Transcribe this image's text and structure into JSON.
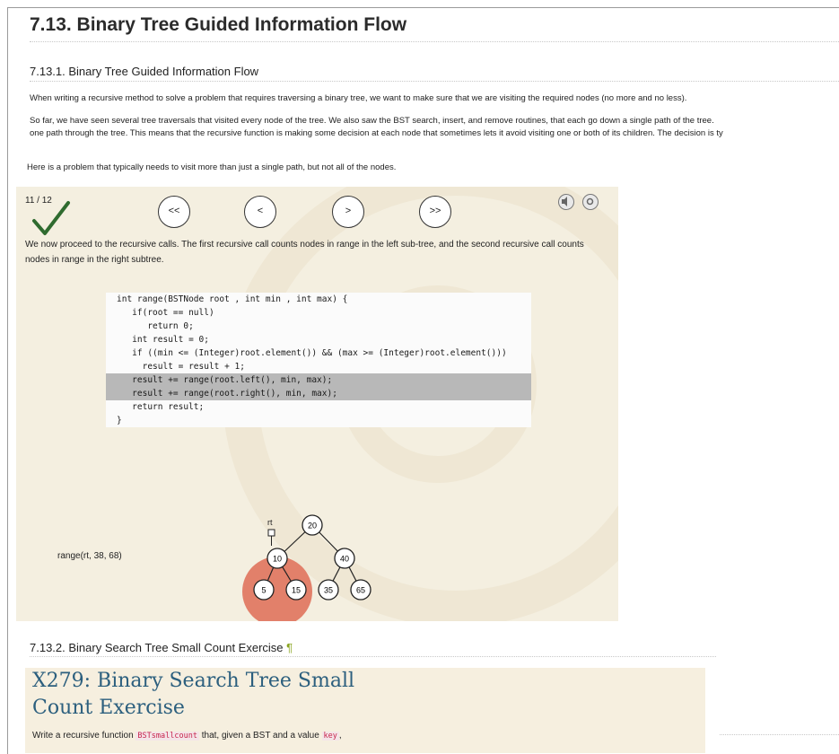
{
  "page": {
    "title": "7.13. Binary Tree Guided Information Flow",
    "section1_heading": "7.13.1. Binary Tree Guided Information Flow",
    "para1": "When writing a recursive method to solve a problem that requires traversing a binary tree, we want to make sure that we are visiting the required nodes (no more and no less).",
    "para2_line1": "So far, we have seen several tree traversals that visited every node of the tree. We also saw the BST search, insert, and remove routines, that each go down a single path of the tree.",
    "para2_line2": "one path through the tree. This means that the recursive function is making some decision at each node that sometimes lets it avoid visiting one or both of its children. The decision is ty",
    "para3": "Here is a problem that typically needs to visit more than just a single path, but not all of the nodes."
  },
  "slideshow": {
    "counter": "11 / 12",
    "buttons": {
      "first": "<<",
      "prev": "<",
      "next": ">",
      "last": ">>"
    },
    "description": "We now proceed to the recursive calls. The first recursive call counts nodes in range in the left sub-tree, and the second recursive call counts nodes in range in the right subtree.",
    "code_lines": [
      "int range(BSTNode root , int min , int max) {",
      "   if(root == null)",
      "      return 0;",
      "   int result = 0;",
      "   if ((min <= (Integer)root.element()) && (max >= (Integer)root.element()))",
      "     result = result + 1;",
      "   result += range(root.left(), min, max);",
      "   result += range(root.right(), min, max);",
      "   return result;",
      "}"
    ],
    "highlighted_lines": [
      6,
      7
    ],
    "call_label": "range(rt, 38, 68)",
    "pointer_label": "rt",
    "tree": {
      "root": "20",
      "n10": "10",
      "n40": "40",
      "n5": "5",
      "n15": "15",
      "n35": "35",
      "n65": "65"
    },
    "highlight_color": "#e2806a",
    "check_color": "#2f6b2f"
  },
  "section2": {
    "heading": "7.13.2. Binary Search Tree Small Count Exercise",
    "pilcrow": "¶",
    "exercise_title_line1": "X279: Binary Search Tree Small",
    "exercise_title_line2": "Count Exercise",
    "text_prefix": "Write a recursive function",
    "fn_name": "BSTsmallcount",
    "text_middle": "that, given a BST and a value",
    "key_name": "key",
    "text_suffix": ","
  }
}
